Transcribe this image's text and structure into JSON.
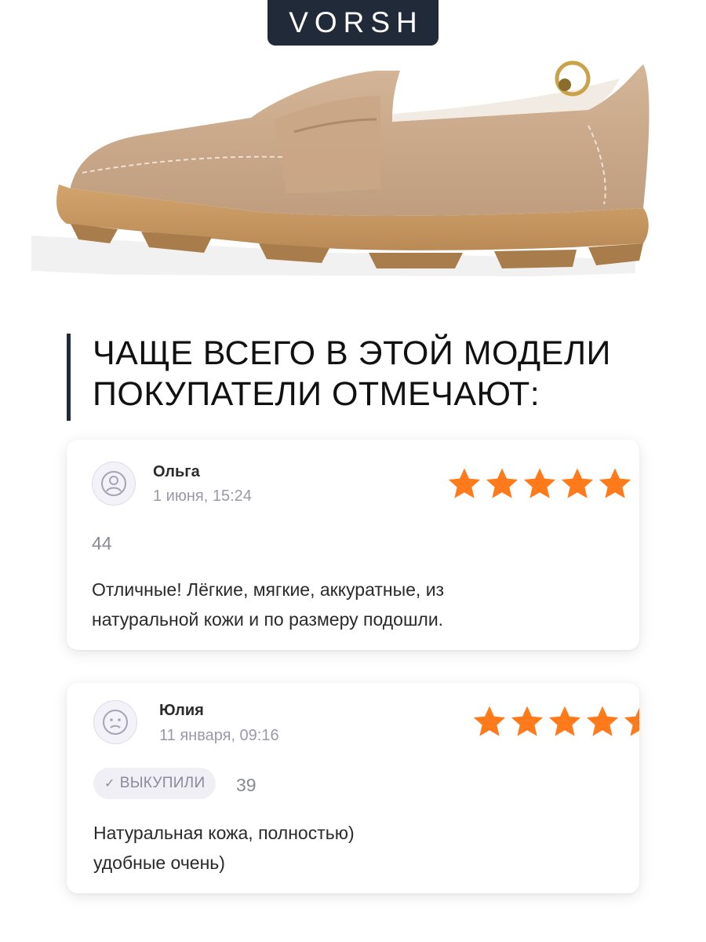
{
  "brand": "VORSH",
  "heading": {
    "line1": "ЧАЩЕ ВСЕГО В ЭТОЙ МОДЕЛИ",
    "line2": "ПОКУПАТЕЛИ ОТМЕЧАЮТ:"
  },
  "colors": {
    "brand_bg": "#212a38",
    "star": "#ff7a1a",
    "suede": "#c9a88a",
    "sole": "#c69660"
  },
  "reviews": [
    {
      "author": "Ольга",
      "date": "1 июня, 15:24",
      "rating": 5,
      "likes": "44",
      "text_line1": "Отличные!  Лёгкие, мягкие, аккуратные, из",
      "text_line2": "натуральной кожи и по размеру подошли."
    },
    {
      "author": "Юлия",
      "date": "11 января, 09:16",
      "rating": 5,
      "badge": "ВЫКУПИЛИ",
      "likes": "39",
      "text_line1": "Натуральная кожа, полностью)",
      "text_line2": "удобные очень)"
    }
  ]
}
